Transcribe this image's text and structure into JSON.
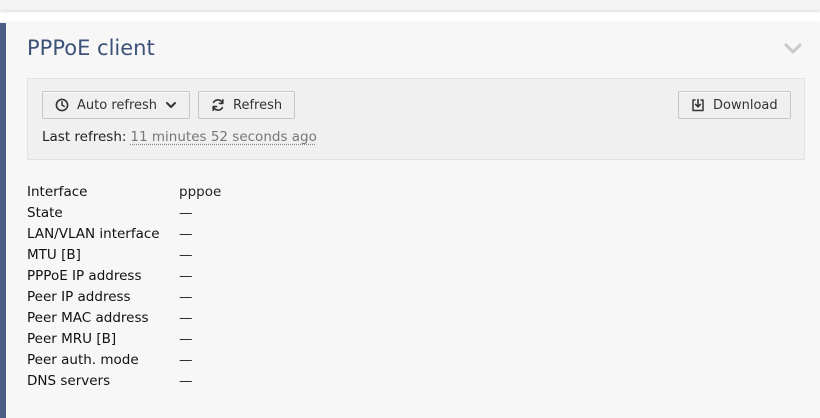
{
  "panel": {
    "title": "PPPoE client"
  },
  "toolbar": {
    "auto_refresh_label": "Auto refresh",
    "refresh_label": "Refresh",
    "download_label": "Download",
    "last_refresh_label": "Last refresh:",
    "last_refresh_value": "11 minutes 52 seconds ago"
  },
  "info": [
    {
      "label": "Interface",
      "value": "pppoe"
    },
    {
      "label": "State",
      "value": "—"
    },
    {
      "label": "LAN/VLAN interface",
      "value": "—"
    },
    {
      "label": "MTU [B]",
      "value": "—"
    },
    {
      "label": "PPPoE IP address",
      "value": "—"
    },
    {
      "label": "Peer IP address",
      "value": "—"
    },
    {
      "label": "Peer MAC address",
      "value": "—"
    },
    {
      "label": "Peer MRU [B]",
      "value": "—"
    },
    {
      "label": "Peer auth. mode",
      "value": "—"
    },
    {
      "label": "DNS servers",
      "value": "—"
    }
  ],
  "icons": {
    "auto_refresh": "clock-icon",
    "auto_refresh_dropdown": "chevron-down-icon",
    "refresh": "refresh-icon",
    "download": "download-icon",
    "collapse": "chevron-down-icon"
  },
  "colors": {
    "accent": "#4a5e86",
    "title": "#3c5277"
  }
}
